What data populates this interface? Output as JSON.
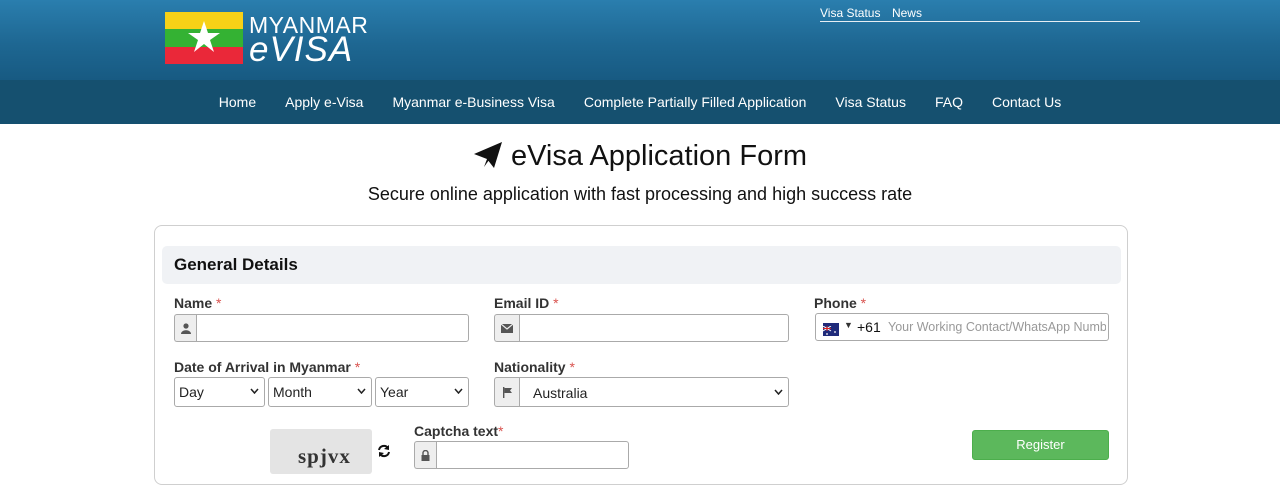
{
  "header": {
    "logo_line1": "MYANMAR",
    "logo_line2": "eVISA",
    "top_links": [
      "Visa Status",
      "News"
    ]
  },
  "nav": {
    "items": [
      "Home",
      "Apply e-Visa",
      "Myanmar e-Business Visa",
      "Complete Partially Filled Application",
      "Visa Status",
      "FAQ",
      "Contact Us"
    ]
  },
  "page": {
    "title": "eVisa Application Form",
    "subtitle": "Secure online application with fast processing and high success rate"
  },
  "form": {
    "section_title": "General Details",
    "name_label": "Name",
    "email_label": "Email ID",
    "phone_label": "Phone",
    "required_mark": "*",
    "phone_code": "+61",
    "phone_placeholder": "Your Working Contact/WhatsApp Number",
    "arrival_label": "Date of Arrival in Myanmar",
    "day_placeholder": "Day",
    "month_placeholder": "Month",
    "year_placeholder": "Year",
    "nationality_label": "Nationality",
    "nationality_value": "Australia",
    "captcha_label": "Captcha text",
    "captcha_image_text": "spjvx",
    "register_label": "Register"
  },
  "colors": {
    "header_top": "#2a7eae",
    "nav_bar": "#15506f",
    "required": "#d9534f",
    "register_button": "#5cb85c"
  },
  "icons": [
    "user-icon",
    "envelope-icon",
    "flag-icon",
    "lock-icon",
    "refresh-icon",
    "paper-plane-icon",
    "australia-flag-icon"
  ]
}
